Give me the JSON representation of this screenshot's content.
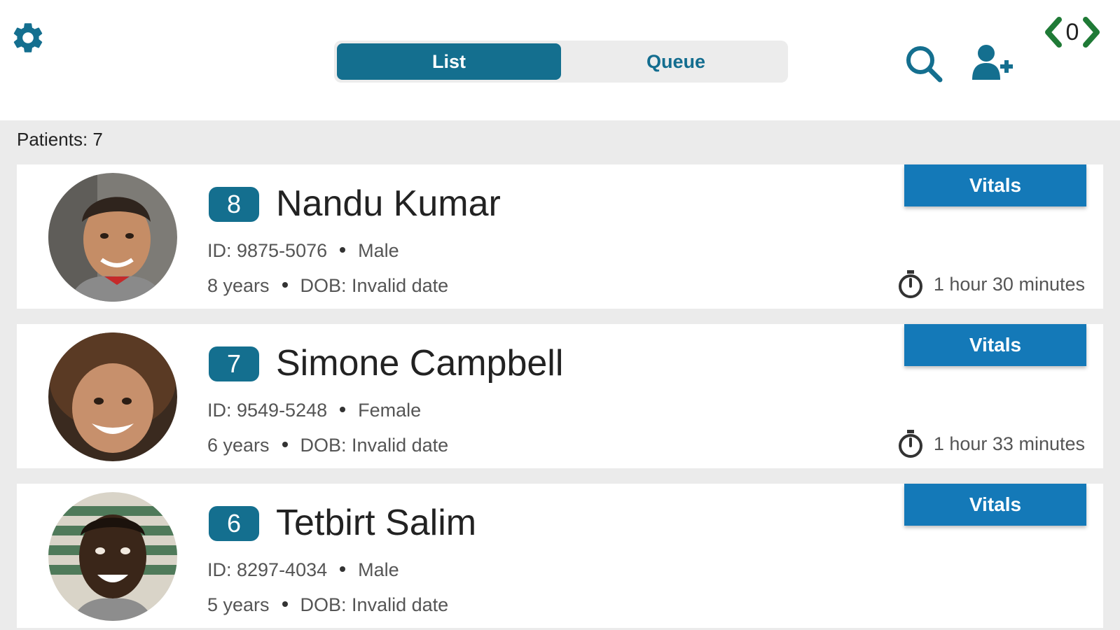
{
  "header": {
    "settings_icon": "gear-icon",
    "tabs": [
      {
        "label": "List",
        "active": true
      },
      {
        "label": "Queue",
        "active": false
      }
    ],
    "search_icon": "search-icon",
    "add_patient_icon": "user-plus-icon",
    "code_count": "0",
    "colors": {
      "primary": "#146f8f",
      "accent_green": "#1f7a36",
      "button_blue": "#1479b8"
    }
  },
  "patients_count_label": "Patients: 7",
  "patients": [
    {
      "number": "8",
      "name": "Nandu Kumar",
      "id": "ID: 9875-5076",
      "gender": "Male",
      "age": "8 years",
      "dob": "DOB: Invalid date",
      "wait": "1 hour 30 minutes",
      "action": "Vitals"
    },
    {
      "number": "7",
      "name": "Simone Campbell",
      "id": "ID: 9549-5248",
      "gender": "Female",
      "age": "6 years",
      "dob": "DOB: Invalid date",
      "wait": "1 hour 33 minutes",
      "action": "Vitals"
    },
    {
      "number": "6",
      "name": "Tetbirt Salim",
      "id": "ID: 8297-4034",
      "gender": "Male",
      "age": "5 years",
      "dob": "DOB: Invalid date",
      "wait": "",
      "action": "Vitals"
    }
  ]
}
